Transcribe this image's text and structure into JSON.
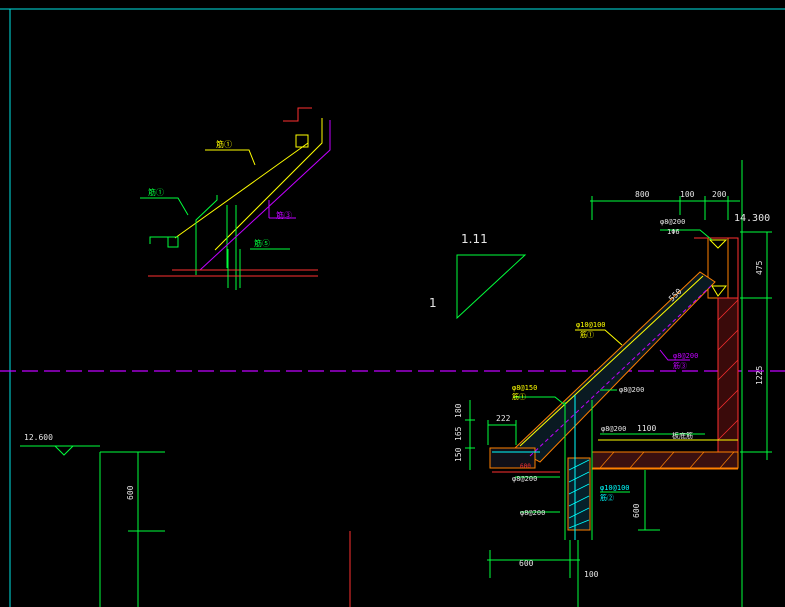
{
  "colors": {
    "background": "#000000",
    "frame": "#00e5e5",
    "dim": "#00ff3c",
    "slab": "#ffff00",
    "magenta": "#c000ff",
    "red": "#ff3030",
    "orange": "#ff8000",
    "cyan": "#00ffff",
    "white": "#e6e6e6"
  },
  "slope": {
    "rise": "1",
    "run": "1.11"
  },
  "elevations": {
    "top": "14.300",
    "left": "12.600"
  },
  "dims": {
    "d800": "800",
    "d100": "100",
    "d200": "200",
    "d475": "475",
    "d1225": "1225",
    "d222": "222",
    "d180": "180",
    "d165": "165",
    "d150": "150",
    "d1100": "1100",
    "d600_h": "600",
    "d100_b": "100",
    "d600_v": "600",
    "d600_left": "600",
    "d600_mid": "600",
    "d550": "550"
  },
  "rebar_labels": {
    "top_a": "φ8@200",
    "top_b": "1Φ6",
    "slope_a": "φ10@100",
    "slope_b": "筋①",
    "mag_a": "φ8@200",
    "mag_b": "筋③",
    "mid": "φ8@200",
    "left_a": "φ8@150",
    "left_b": "筋①",
    "bottom_a": "φ8@200",
    "bottom_note": "板底筋",
    "low_a": "φ8@200",
    "low_b": "φ8@200",
    "col_a": "φ10@100",
    "col_b": "筋②"
  },
  "detail_labels": {
    "bar1": "筋①",
    "bar2": "筋①",
    "bar3": "筋③",
    "bar4": "筋⑤"
  }
}
